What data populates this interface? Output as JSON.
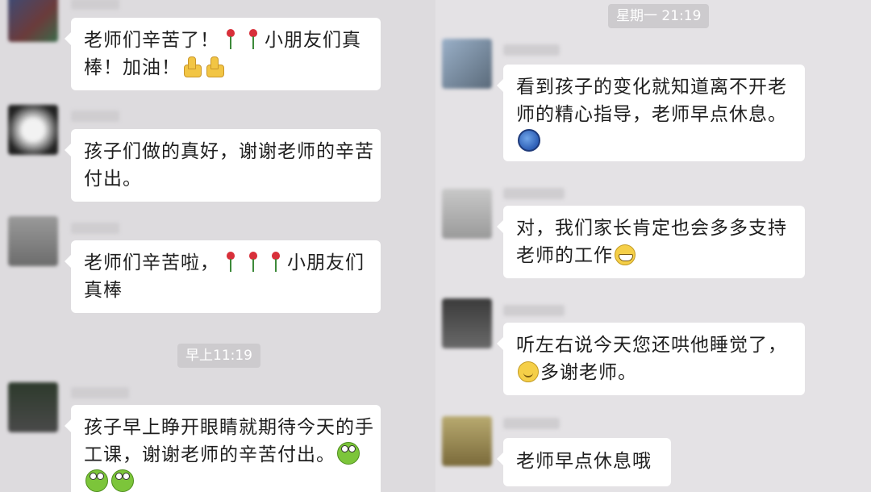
{
  "left": {
    "messages": [
      {
        "lines": [
          "老师们辛苦了！",
          "棒！加油！"
        ],
        "middle_text": "小朋友们真",
        "emojis": [
          "rose-icon",
          "rose-icon",
          "thumbs-up-icon",
          "thumbs-up-icon"
        ],
        "avatar_color": "#4a5a7a"
      },
      {
        "lines": [
          "孩子们做的真好，谢谢老师的辛苦",
          "付出。"
        ],
        "emojis": [],
        "avatar_color": "#2c2c2c"
      },
      {
        "lines": [
          "老师们辛苦啦，",
          "小朋友们",
          "真棒"
        ],
        "emojis": [
          "rose-icon",
          "rose-icon",
          "rose-icon"
        ],
        "avatar_color": "#8c8c8c"
      }
    ],
    "time_divider": "早上11:19",
    "last_message": {
      "lines": [
        "孩子早上睁开眼睛就期待今天的手",
        "工课，谢谢老师的辛苦付出。"
      ],
      "emojis": [
        "frog-icon",
        "frog-icon",
        "frog-icon"
      ],
      "avatar_color": "#3b4a3a"
    }
  },
  "right": {
    "time_divider": "星期一 21:19",
    "messages": [
      {
        "lines": [
          "看到孩子的变化就知道离不开老",
          "师的精心指导，老师早点休息。"
        ],
        "emojis": [
          "globe-icon"
        ],
        "avatar_color": "#7a8aa0"
      },
      {
        "lines": [
          "对，我们家长肯定也会多多支持",
          "老师的工作"
        ],
        "emojis": [
          "grin-icon"
        ],
        "avatar_color": "#b0b0b0"
      },
      {
        "lines": [
          "听左右说今天您还哄他睡觉了，",
          "多谢老师。"
        ],
        "emojis": [
          "smile-icon"
        ],
        "avatar_color": "#5a5a5a"
      },
      {
        "lines": [
          "老师早点休息哦"
        ],
        "emojis": [],
        "avatar_color": "#a89a6a"
      }
    ]
  }
}
